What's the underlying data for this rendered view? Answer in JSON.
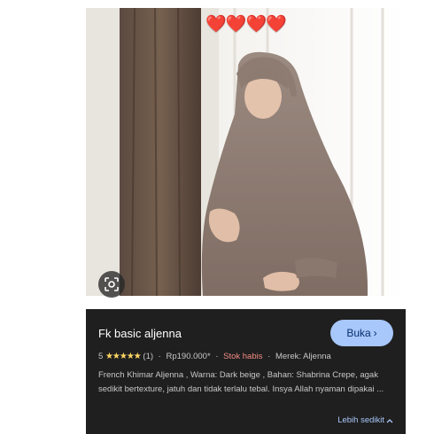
{
  "photo": {
    "overlay_hearts": "❤️❤️❤️❤️",
    "lens_icon": "lens-search-icon"
  },
  "product": {
    "title": "Fk basic aljenna",
    "open_button_label": "Buka",
    "rating_value": "5",
    "stars": "★★★★★",
    "review_count": "(1)",
    "price": "Rp190.000*",
    "stock_status": "Stok habis",
    "brand": "Merek: Aljenna",
    "description": "French Khimar Aljenna , Warna: Dark beige , Bahan: Shabrina Crepe, agak sedikit bertexture, jatuh dan tidak terlalu tebal. Insya Allah nyaman dipakai ...",
    "less_label": "Lebih sedikit"
  },
  "colors": {
    "card_bg": "#1f1f1f",
    "button_bg": "#a8c7fa",
    "stars": "#fdd663",
    "stock": "#f28b82",
    "link": "#a8c7fa"
  }
}
